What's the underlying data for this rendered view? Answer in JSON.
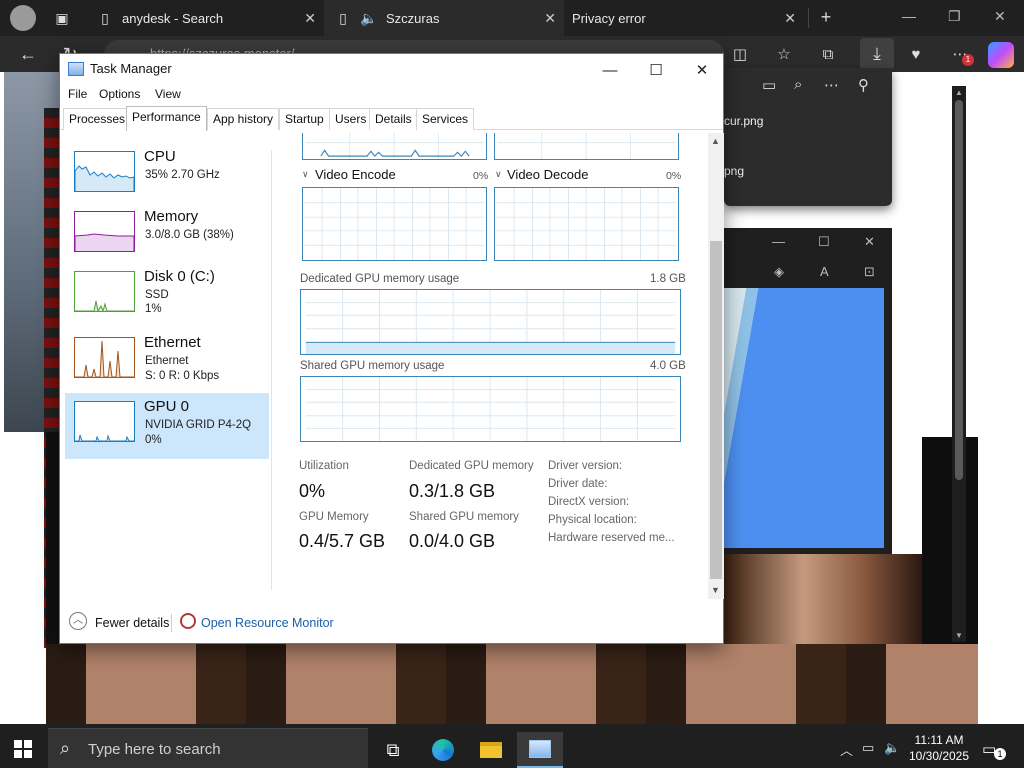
{
  "browser": {
    "tabs": [
      {
        "label": "anydesk - Search",
        "close": "✕"
      },
      {
        "label": "Szczuras",
        "close": "✕"
      },
      {
        "label": "Privacy error",
        "close": "✕"
      }
    ],
    "new_tab": "+",
    "window_controls": {
      "minimize": "—",
      "restore": "❐",
      "close": "✕"
    },
    "address": "https://szczuras.monster/",
    "download_badge": "1"
  },
  "downloads_flyout": {
    "files": [
      "cur.png",
      "png"
    ]
  },
  "task_manager": {
    "title": "Task Manager",
    "menu": [
      "File",
      "Options",
      "View"
    ],
    "tabs": [
      "Processes",
      "Performance",
      "App history",
      "Startup",
      "Users",
      "Details",
      "Services"
    ],
    "active_tab": "Performance",
    "sidebar": [
      {
        "name": "CPU",
        "line1": "35%  2.70 GHz",
        "line2": "",
        "color": "#1a7dc1"
      },
      {
        "name": "Memory",
        "line1": "3.0/8.0 GB (38%)",
        "line2": "",
        "color": "#8b1f9c"
      },
      {
        "name": "Disk 0 (C:)",
        "line1": "SSD",
        "line2": "1%",
        "color": "#4da033"
      },
      {
        "name": "Ethernet",
        "line1": "Ethernet",
        "line2": "S: 0  R: 0 Kbps",
        "color": "#a4541c"
      },
      {
        "name": "GPU 0",
        "line1": "NVIDIA GRID P4-2Q",
        "line2": "0%",
        "color": "#1a7dc1"
      }
    ],
    "gpu": {
      "video_encode": {
        "label": "Video Encode",
        "value": "0%"
      },
      "video_decode": {
        "label": "Video Decode",
        "value": "0%"
      },
      "dedicated_graph": {
        "label": "Dedicated GPU memory usage",
        "max": "1.8 GB"
      },
      "shared_graph": {
        "label": "Shared GPU memory usage",
        "max": "4.0 GB"
      },
      "stats": {
        "utilization": {
          "label": "Utilization",
          "value": "0%"
        },
        "dedicated": {
          "label": "Dedicated GPU memory",
          "value": "0.3/1.8 GB"
        },
        "gpu_memory": {
          "label": "GPU Memory",
          "value": "0.4/5.7 GB"
        },
        "shared": {
          "label": "Shared GPU memory",
          "value": "0.0/4.0 GB"
        }
      },
      "info": [
        "Driver version:",
        "Driver date:",
        "DirectX version:",
        "Physical location:",
        "Hardware reserved me..."
      ]
    },
    "footer": {
      "fewer_details": "Fewer details",
      "open_monitor": "Open Resource Monitor"
    }
  },
  "taskbar": {
    "search_placeholder": "Type here to search",
    "time": "11:11 AM",
    "date": "10/30/2025",
    "notification_count": "1"
  },
  "colors": {
    "graph_border": "#3a88b9",
    "selected_bg": "#cce6fb",
    "link": "#1a5fa8"
  }
}
